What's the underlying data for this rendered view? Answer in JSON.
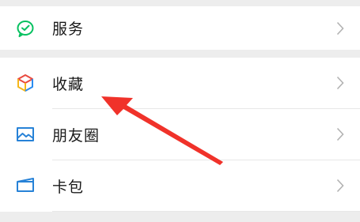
{
  "menu": {
    "service": {
      "label": "服务",
      "icon": "wechat-pay-icon",
      "color": "#07c160"
    },
    "items": [
      {
        "label": "收藏",
        "icon": "favorites-cube-icon"
      },
      {
        "label": "朋友圈",
        "icon": "moments-image-icon",
        "color": "#2782d7"
      },
      {
        "label": "卡包",
        "icon": "card-wallet-icon",
        "color": "#2782d7"
      }
    ]
  },
  "annotation": {
    "icon": "red-arrow-pointer",
    "color": "#f0322a"
  }
}
